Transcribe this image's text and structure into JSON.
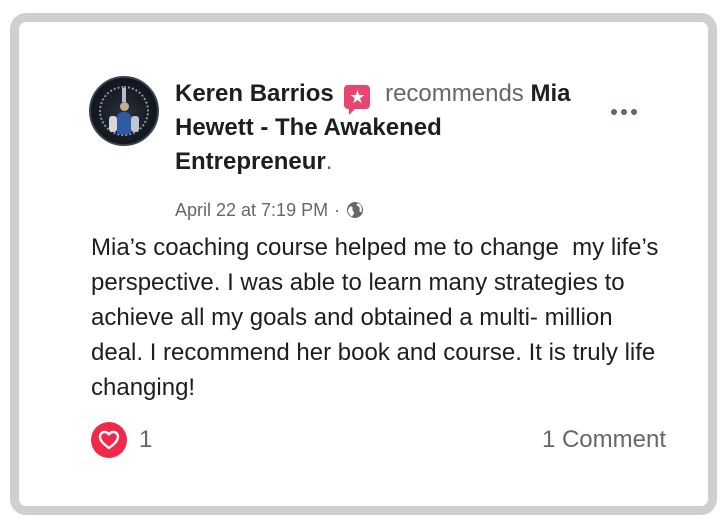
{
  "post": {
    "author": "Keren Barrios",
    "verb": "recommends",
    "page_name": "Mia Hewett - The Awakened Entrepreneur",
    "page_suffix": ".",
    "timestamp": "April 22 at 7:19 PM",
    "separator": "·",
    "privacy_icon": "globe-icon",
    "more_icon": "more-options-icon",
    "body": "Mia’s coaching course helped me to change  my life’s perspective. I was able to learn many strategies to achieve all my goals and obtained a multi- million deal. I recommend her book and course. It is truly life changing!"
  },
  "footer": {
    "reaction_icon": "heart-icon",
    "reaction_count": "1",
    "comments_label": "1 Comment"
  },
  "colors": {
    "frame": "#cfcfd2",
    "recommend_badge": "#e8456f",
    "heart": "#f0284a",
    "secondary_text": "#65676b",
    "primary_text": "#1c1e21"
  }
}
